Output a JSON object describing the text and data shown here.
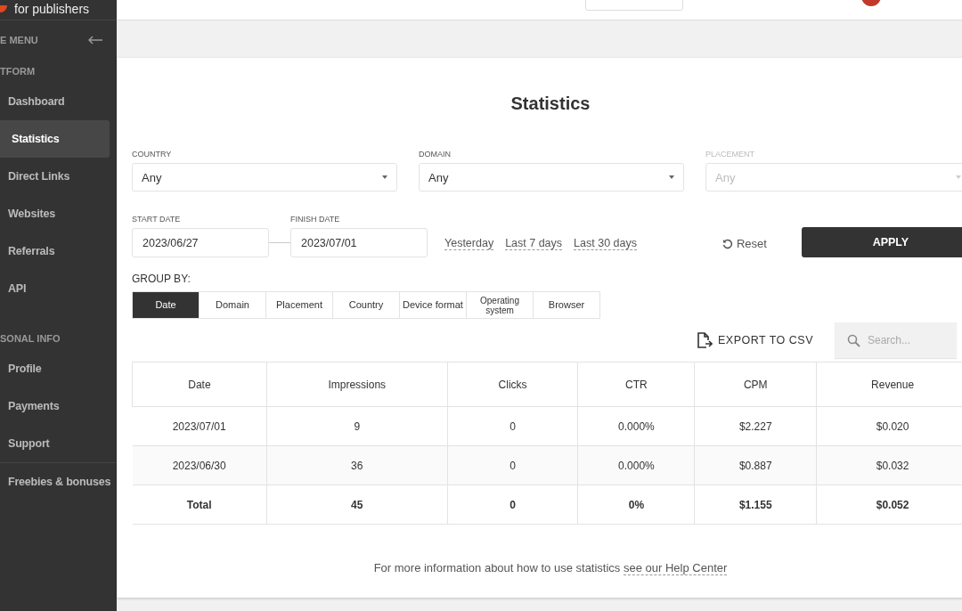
{
  "sidebar": {
    "logo_text": "for publishers",
    "menu_label": "E MENU",
    "sections": [
      {
        "title": "TFORM",
        "items": [
          {
            "label": "Dashboard",
            "selected": false
          },
          {
            "label": "Statistics",
            "selected": true
          },
          {
            "label": "Direct Links",
            "selected": false
          },
          {
            "label": "Websites",
            "selected": false
          },
          {
            "label": "Referrals",
            "selected": false
          },
          {
            "label": "API",
            "selected": false
          }
        ]
      },
      {
        "title": "SONAL INFO",
        "items": [
          {
            "label": "Profile",
            "selected": false
          },
          {
            "label": "Payments",
            "selected": false
          },
          {
            "label": "Support",
            "selected": false
          }
        ]
      }
    ],
    "extra_items": [
      {
        "label": "Freebies & bonuses",
        "selected": false
      }
    ]
  },
  "page": {
    "title": "Statistics",
    "filters": [
      {
        "label": "COUNTRY",
        "value": "Any",
        "disabled": false
      },
      {
        "label": "DOMAIN",
        "value": "Any",
        "disabled": false
      },
      {
        "label": "PLACEMENT",
        "value": "Any",
        "disabled": true
      }
    ],
    "start_date": {
      "label": "START DATE",
      "value": "2023/06/27"
    },
    "finish_date": {
      "label": "FINISH DATE",
      "value": "2023/07/01"
    },
    "presets": [
      "Yesterday",
      "Last 7 days",
      "Last 30 days"
    ],
    "reset": "Reset",
    "apply": "APPLY",
    "group_by": {
      "label": "GROUP BY:",
      "options": [
        {
          "label": "Date",
          "selected": true
        },
        {
          "label": "Domain",
          "selected": false
        },
        {
          "label": "Placement",
          "selected": false
        },
        {
          "label": "Country",
          "selected": false
        },
        {
          "label": "Device format",
          "selected": false
        },
        {
          "label": "Operating system",
          "selected": false
        },
        {
          "label": "Browser",
          "selected": false
        }
      ]
    },
    "export": "EXPORT TO CSV",
    "search": {
      "placeholder": "Search..."
    },
    "table": {
      "columns": [
        "Date",
        "Impressions",
        "Clicks",
        "CTR",
        "CPM",
        "Revenue"
      ],
      "rows": [
        [
          "2023/07/01",
          "9",
          "0",
          "0.000%",
          "$2.227",
          "$0.020"
        ],
        [
          "2023/06/30",
          "36",
          "0",
          "0.000%",
          "$0.887",
          "$0.032"
        ]
      ],
      "total": [
        "Total",
        "45",
        "0",
        "0%",
        "$1.155",
        "$0.052"
      ]
    },
    "footer": {
      "text": "For more information about how to use statistics",
      "link": "see our Help Center"
    }
  }
}
